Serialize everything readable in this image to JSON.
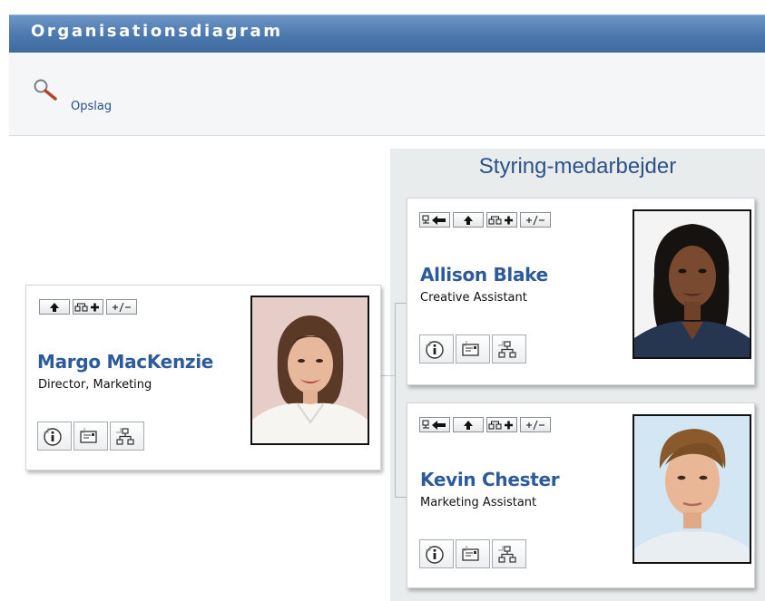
{
  "header": {
    "title": "Organisationsdiagram"
  },
  "toolbar": {
    "lookup_label": "Opslag"
  },
  "group": {
    "title": "Styring-medarbejder"
  },
  "people": {
    "manager": {
      "name": "Margo MacKenzie",
      "title": "Director, Marketing"
    },
    "report1": {
      "name": "Allison Blake",
      "title": "Creative Assistant"
    },
    "report2": {
      "name": "Kevin Chester",
      "title": "Marketing Assistant"
    }
  },
  "icons": {
    "lookup": "magnifier-icon",
    "up": "arrow-up-icon",
    "show_subordinates": "org-expand-icon",
    "toggle": "plus-minus-icon",
    "back_to_manager": "org-back-icon",
    "info": "info-icon",
    "email": "email-icon",
    "org": "org-chart-icon"
  },
  "colors": {
    "header": "#4b78ae",
    "name": "#2d5a9b",
    "group_title": "#2c5289",
    "group_bg": "#e9ecec"
  }
}
